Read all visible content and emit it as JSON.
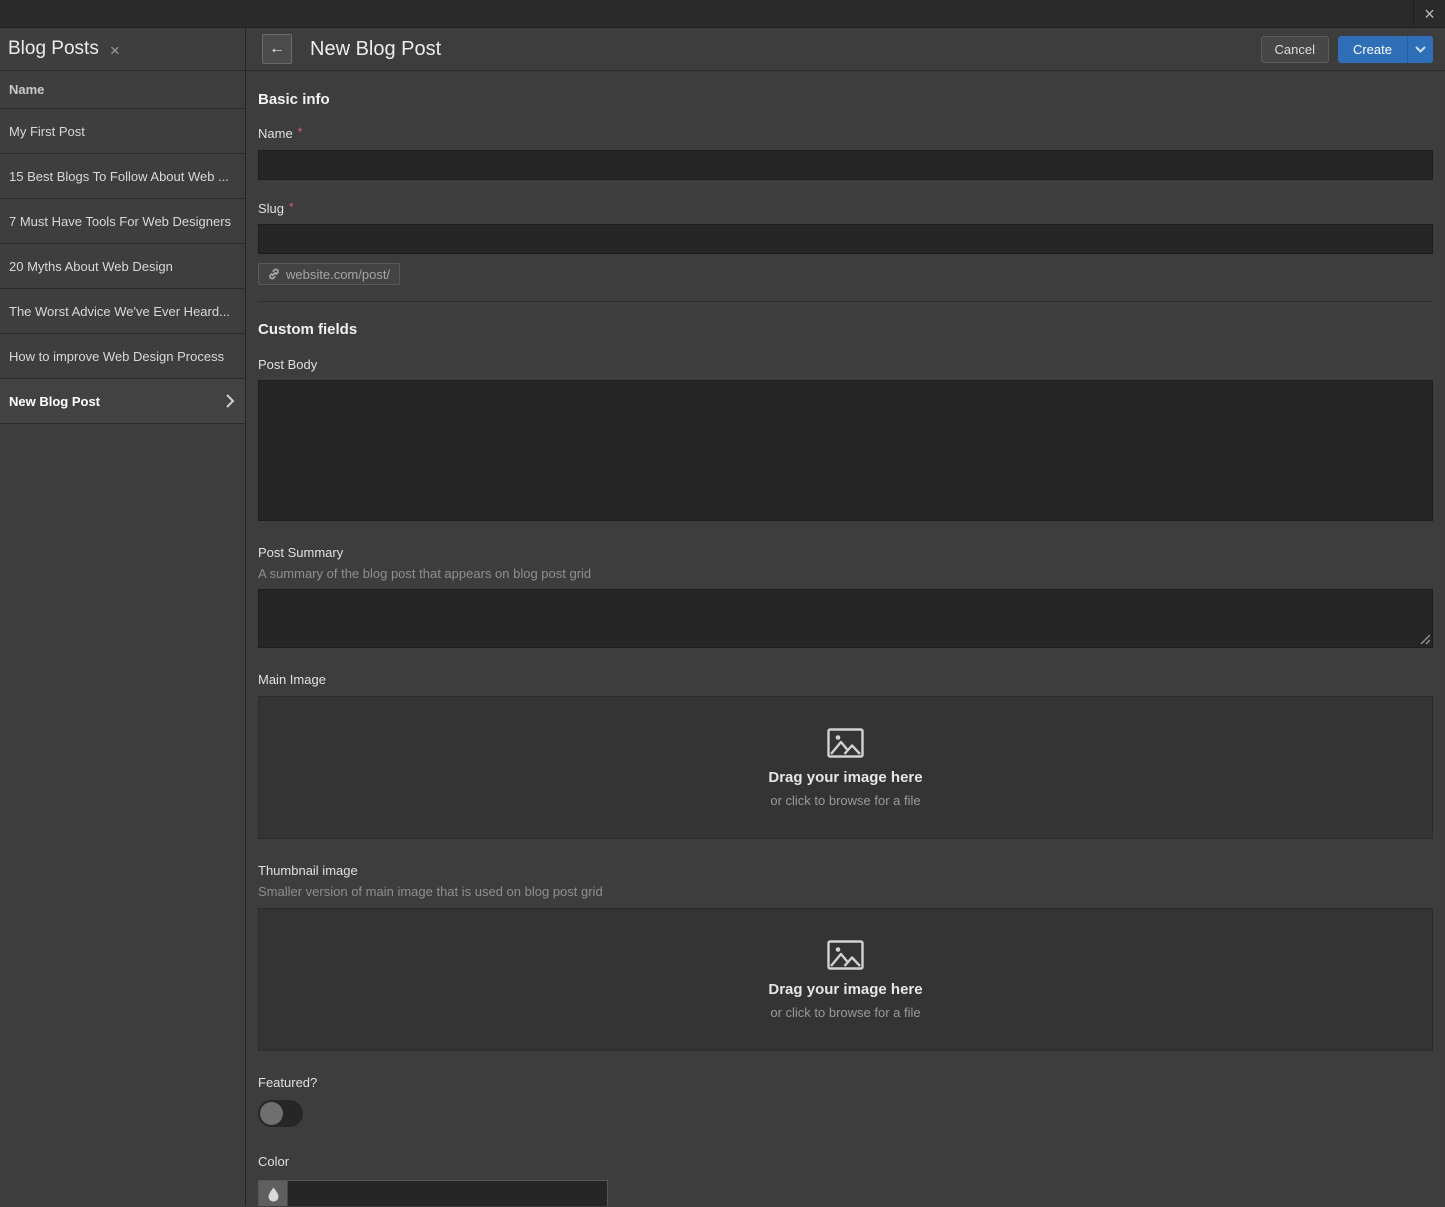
{
  "icons": {
    "close": "×",
    "back_arrow": "←"
  },
  "window": {
    "close_label": "×"
  },
  "sidebar": {
    "title": "Blog Posts",
    "column_header": "Name",
    "items": [
      {
        "label": "My First Post",
        "selected": false
      },
      {
        "label": "15 Best Blogs To Follow About Web ...",
        "selected": false
      },
      {
        "label": "7 Must Have Tools For Web Designers",
        "selected": false
      },
      {
        "label": "20 Myths About Web Design",
        "selected": false
      },
      {
        "label": "The Worst Advice We've Ever Heard...",
        "selected": false
      },
      {
        "label": "How to improve Web Design Process",
        "selected": false
      },
      {
        "label": "New Blog Post",
        "selected": true
      }
    ]
  },
  "header": {
    "title": "New Blog Post",
    "cancel_label": "Cancel",
    "create_label": "Create"
  },
  "basic_info": {
    "heading": "Basic info",
    "name_label": "Name",
    "name_required_mark": "*",
    "name_value": "",
    "slug_label": "Slug",
    "slug_required_mark": "*",
    "slug_value": "",
    "slug_prefix": "website.com/post/"
  },
  "custom_fields": {
    "heading": "Custom fields",
    "post_body": {
      "label": "Post Body",
      "value": ""
    },
    "post_summary": {
      "label": "Post Summary",
      "help": "A summary of the blog post that appears on blog post grid",
      "value": ""
    },
    "main_image": {
      "label": "Main Image",
      "drop_title": "Drag your image here",
      "drop_subtitle": "or click to browse for a file"
    },
    "thumbnail_image": {
      "label": "Thumbnail image",
      "help": "Smaller version of main image that is used on blog post grid",
      "drop_title": "Drag your image here",
      "drop_subtitle": "or click to browse for a file"
    },
    "featured": {
      "label": "Featured?",
      "value": false
    },
    "color": {
      "label": "Color",
      "value": ""
    }
  },
  "colors": {
    "accent_blue": "#2e6fb8",
    "required_red": "#e05c6d",
    "panel_bg": "#3d3d3d",
    "input_bg": "#262626",
    "titlebar_bg": "#2b2b2b"
  }
}
